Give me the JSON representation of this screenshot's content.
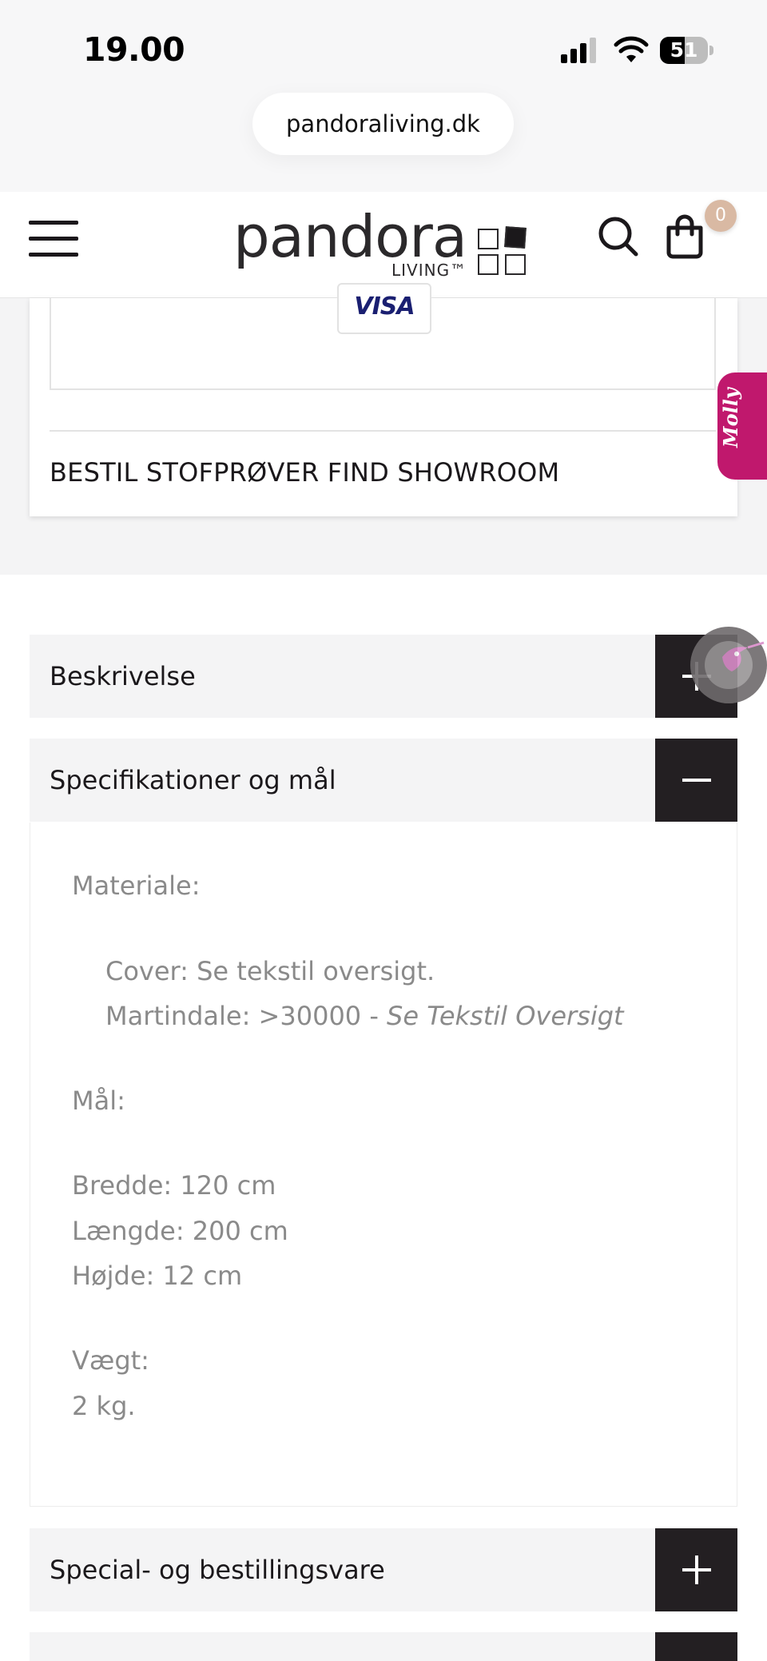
{
  "status_bar": {
    "time": "19.00",
    "battery_level": "51",
    "icons": [
      "cellular-signal-icon",
      "wifi-icon",
      "battery-icon"
    ]
  },
  "browser": {
    "url": "pandoraliving.dk"
  },
  "header": {
    "logo_word": "pandora",
    "logo_sub": "LIVING™",
    "cart_count": "0",
    "icons": [
      "menu-icon",
      "search-icon",
      "cart-icon"
    ]
  },
  "payment": {
    "visa_label": "VISA"
  },
  "links": {
    "text": "BESTIL STOFPRØVER FIND SHOWROOM"
  },
  "molly": {
    "label": "Molly"
  },
  "accordion": {
    "items": [
      {
        "title": "Beskrivelse",
        "state": "collapsed"
      },
      {
        "title": "Specifikationer og mål",
        "state": "expanded"
      },
      {
        "title": "Special- og bestillingsvare",
        "state": "collapsed"
      }
    ]
  },
  "specs": {
    "material_label": "Materiale:",
    "cover": "Cover: Se tekstil oversigt.",
    "martindale_prefix": "Martindale: >30000 - ",
    "martindale_link": "Se Tekstil Oversigt",
    "dims_label": "Mål:",
    "width": "Bredde: 120 cm",
    "length": "Længde: 200 cm",
    "height": "Højde: 12 cm",
    "weight_label": "Vægt:",
    "weight": "2 kg."
  },
  "colors": {
    "accent_dark": "#231f22",
    "molly_magenta": "#c0186d",
    "badge": "#d9b9a3",
    "visa_blue": "#1a1f71"
  }
}
